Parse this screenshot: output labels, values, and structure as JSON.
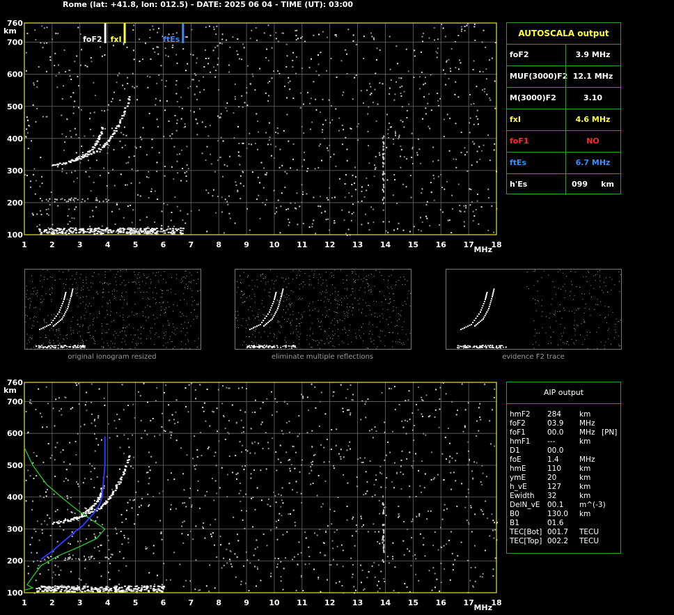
{
  "title": "Rome (lat: +41.8, lon: 012.5) - DATE: 2025 06 04 - TIME (UT): 03:00",
  "chart_data": [
    {
      "type": "scatter",
      "name_hint": "main-ionogram",
      "x_ticks": [
        1,
        2,
        3,
        4,
        5,
        6,
        7,
        8,
        9,
        10,
        11,
        12,
        13,
        14,
        15,
        16,
        17,
        18
      ],
      "y_ticks": [
        100,
        200,
        300,
        400,
        500,
        600,
        700,
        760
      ],
      "xlim": [
        1,
        18
      ],
      "ylim": [
        100,
        760
      ],
      "xlabel": "MHz",
      "ylabel": "km",
      "grid": true,
      "markers": [
        {
          "label": "foF2",
          "x": 3.9,
          "color": "#ffffff"
        },
        {
          "label": "fxI",
          "x": 4.6,
          "color": "#ffff3a"
        },
        {
          "label": "ftEs",
          "x": 6.7,
          "color": "#3a8cff"
        }
      ],
      "traces": {
        "o_trace": [
          [
            2.0,
            320
          ],
          [
            2.4,
            325
          ],
          [
            2.8,
            335
          ],
          [
            3.2,
            355
          ],
          [
            3.4,
            370
          ],
          [
            3.6,
            390
          ],
          [
            3.7,
            410
          ],
          [
            3.8,
            440
          ]
        ],
        "x_trace": [
          [
            2.6,
            330
          ],
          [
            3.0,
            340
          ],
          [
            3.4,
            355
          ],
          [
            3.8,
            375
          ],
          [
            4.0,
            395
          ],
          [
            4.2,
            420
          ],
          [
            4.4,
            450
          ],
          [
            4.6,
            490
          ],
          [
            4.8,
            540
          ]
        ],
        "es_layer": [
          [
            1.4,
            110
          ],
          [
            2.0,
            110
          ],
          [
            3.0,
            110
          ],
          [
            4.0,
            110
          ],
          [
            5.0,
            110
          ],
          [
            6.0,
            110
          ],
          [
            6.7,
            110
          ]
        ]
      }
    },
    {
      "type": "scatter",
      "name_hint": "aip-ionogram",
      "x_ticks": [
        1,
        2,
        3,
        4,
        5,
        6,
        7,
        8,
        9,
        10,
        11,
        12,
        13,
        14,
        15,
        16,
        17,
        18
      ],
      "y_ticks": [
        100,
        200,
        300,
        400,
        500,
        600,
        700,
        760
      ],
      "xlim": [
        1,
        18
      ],
      "ylim": [
        100,
        760
      ],
      "xlabel": "MHz",
      "ylabel": "km",
      "grid": true,
      "profile_green": [
        [
          1.0,
          555
        ],
        [
          1.3,
          500
        ],
        [
          1.8,
          440
        ],
        [
          2.4,
          395
        ],
        [
          2.9,
          360
        ],
        [
          3.4,
          330
        ],
        [
          3.9,
          300
        ],
        [
          3.6,
          270
        ],
        [
          3.0,
          245
        ],
        [
          2.2,
          215
        ],
        [
          1.6,
          185
        ],
        [
          1.3,
          150
        ],
        [
          1.1,
          125
        ],
        [
          1.3,
          115
        ],
        [
          1.0,
          108
        ]
      ],
      "profile_blue": [
        [
          1.6,
          205
        ],
        [
          2.0,
          230
        ],
        [
          2.4,
          260
        ],
        [
          2.8,
          290
        ],
        [
          3.1,
          310
        ],
        [
          3.3,
          330
        ],
        [
          3.5,
          350
        ],
        [
          3.7,
          375
        ],
        [
          3.8,
          400
        ],
        [
          3.85,
          450
        ],
        [
          3.9,
          500
        ],
        [
          3.9,
          590
        ]
      ]
    }
  ],
  "autoscala": {
    "header": "AUTOSCALA output",
    "rows": [
      {
        "label": "foF2",
        "value": "3.9 MHz",
        "color": "#ffffff"
      },
      {
        "label": "MUF(3000)F2",
        "value": "12.1 MHz",
        "color": "#ffffff"
      },
      {
        "label": "M(3000)F2",
        "value": "3.10",
        "color": "#ffffff"
      },
      {
        "label": "fxI",
        "value": "4.6 MHz",
        "color": "#ffff3a"
      },
      {
        "label": "foF1",
        "value": "NO",
        "color": "#ff2a2a"
      },
      {
        "label": "ftEs",
        "value": "6.7 MHz",
        "color": "#3a8cff"
      },
      {
        "label": "h'Es",
        "value": "099     km",
        "color": "#ffffff"
      }
    ]
  },
  "thumbnails": [
    {
      "caption": "original ionogram resized"
    },
    {
      "caption": "eliminate multiple reflections"
    },
    {
      "caption": "evidence F2 trace"
    }
  ],
  "aip": {
    "header": "AIP output",
    "rows": [
      {
        "param": "hmF2",
        "value": "284",
        "unit": "km",
        "extra": ""
      },
      {
        "param": "foF2",
        "value": "03.9",
        "unit": "MHz",
        "extra": ""
      },
      {
        "param": "foF1",
        "value": "00.0",
        "unit": "MHz",
        "extra": "[PN]"
      },
      {
        "param": "hmF1",
        "value": "---",
        "unit": "km",
        "extra": ""
      },
      {
        "param": "D1",
        "value": "00.0",
        "unit": "",
        "extra": ""
      },
      {
        "param": "foE",
        "value": "1.4",
        "unit": "MHz",
        "extra": ""
      },
      {
        "param": "hmE",
        "value": "110",
        "unit": "km",
        "extra": ""
      },
      {
        "param": "ymE",
        "value": "20",
        "unit": "km",
        "extra": ""
      },
      {
        "param": "h_vE",
        "value": "127",
        "unit": "km",
        "extra": ""
      },
      {
        "param": "Ewidth",
        "value": "32",
        "unit": "km",
        "extra": ""
      },
      {
        "param": "DelN_vE",
        "value": "00.1",
        "unit": "m^(-3)",
        "extra": ""
      },
      {
        "param": "B0",
        "value": "130.0",
        "unit": "km",
        "extra": ""
      },
      {
        "param": "B1",
        "value": "01.6",
        "unit": "",
        "extra": ""
      },
      {
        "param": "TEC[Bot]",
        "value": "001.7",
        "unit": "TECU",
        "extra": ""
      },
      {
        "param": "TEC[Top]",
        "value": "002.2",
        "unit": "TECU",
        "extra": ""
      }
    ]
  }
}
